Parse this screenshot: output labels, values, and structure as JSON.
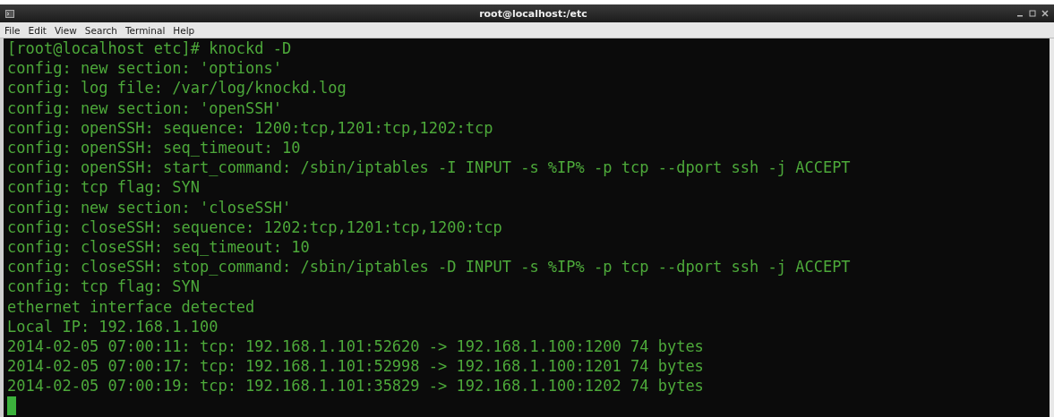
{
  "window": {
    "title": "root@localhost:/etc"
  },
  "menu": [
    "File",
    "Edit",
    "View",
    "Search",
    "Terminal",
    "Help"
  ],
  "terminal": {
    "lines": [
      "[root@localhost etc]# knockd -D",
      "config: new section: 'options'",
      "config: log file: /var/log/knockd.log",
      "config: new section: 'openSSH'",
      "config: openSSH: sequence: 1200:tcp,1201:tcp,1202:tcp",
      "config: openSSH: seq_timeout: 10",
      "config: openSSH: start_command: /sbin/iptables -I INPUT -s %IP% -p tcp --dport ssh -j ACCEPT",
      "config: tcp flag: SYN",
      "config: new section: 'closeSSH'",
      "config: closeSSH: sequence: 1202:tcp,1201:tcp,1200:tcp",
      "config: closeSSH: seq_timeout: 10",
      "config: closeSSH: stop_command: /sbin/iptables -D INPUT -s %IP% -p tcp --dport ssh -j ACCEPT",
      "config: tcp flag: SYN",
      "ethernet interface detected",
      "Local IP: 192.168.1.100",
      "2014-02-05 07:00:11: tcp: 192.168.1.101:52620 -> 192.168.1.100:1200 74 bytes",
      "2014-02-05 07:00:17: tcp: 192.168.1.101:52998 -> 192.168.1.100:1201 74 bytes",
      "2014-02-05 07:00:19: tcp: 192.168.1.101:35829 -> 192.168.1.100:1202 74 bytes"
    ]
  }
}
